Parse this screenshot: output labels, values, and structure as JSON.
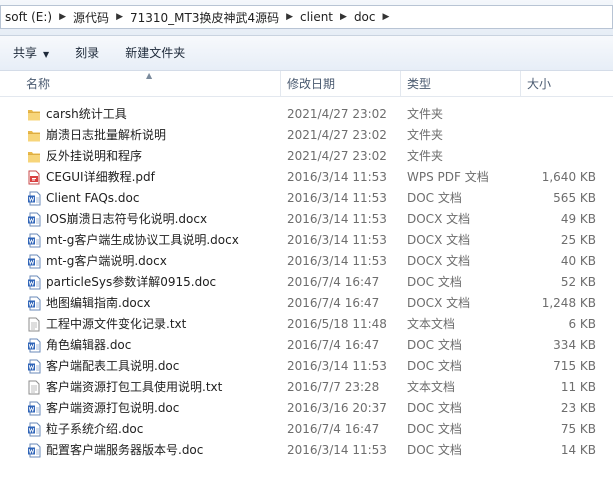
{
  "breadcrumb": [
    "soft (E:)",
    "源代码",
    "71310_MT3换皮神武4源码",
    "client",
    "doc"
  ],
  "toolbar": {
    "share": "共享",
    "burn": "刻录",
    "new_folder": "新建文件夹"
  },
  "columns": {
    "name": "名称",
    "date": "修改日期",
    "type": "类型",
    "size": "大小"
  },
  "files": [
    {
      "name": "carsh统计工具",
      "date": "2021/4/27 23:02",
      "type": "文件夹",
      "size": "",
      "icon": "folder-icon"
    },
    {
      "name": "崩溃日志批量解析说明",
      "date": "2021/4/27 23:02",
      "type": "文件夹",
      "size": "",
      "icon": "folder-icon"
    },
    {
      "name": "反外挂说明和程序",
      "date": "2021/4/27 23:02",
      "type": "文件夹",
      "size": "",
      "icon": "folder-icon"
    },
    {
      "name": "CEGUI详细教程.pdf",
      "date": "2016/3/14 11:53",
      "type": "WPS PDF 文档",
      "size": "1,640 KB",
      "icon": "pdf-icon"
    },
    {
      "name": "Client FAQs.doc",
      "date": "2016/3/14 11:53",
      "type": "DOC 文档",
      "size": "565 KB",
      "icon": "word-doc-icon"
    },
    {
      "name": "IOS崩溃日志符号化说明.docx",
      "date": "2016/3/14 11:53",
      "type": "DOCX 文档",
      "size": "49 KB",
      "icon": "word-doc-icon"
    },
    {
      "name": "mt-g客户端生成协议工具说明.docx",
      "date": "2016/3/14 11:53",
      "type": "DOCX 文档",
      "size": "25 KB",
      "icon": "word-doc-icon"
    },
    {
      "name": "mt-g客户端说明.docx",
      "date": "2016/3/14 11:53",
      "type": "DOCX 文档",
      "size": "40 KB",
      "icon": "word-doc-icon"
    },
    {
      "name": "particleSys参数详解0915.doc",
      "date": "2016/7/4 16:47",
      "type": "DOC 文档",
      "size": "52 KB",
      "icon": "word-doc-icon"
    },
    {
      "name": "地图编辑指南.docx",
      "date": "2016/7/4 16:47",
      "type": "DOCX 文档",
      "size": "1,248 KB",
      "icon": "word-doc-icon"
    },
    {
      "name": "工程中源文件变化记录.txt",
      "date": "2016/5/18 11:48",
      "type": "文本文档",
      "size": "6 KB",
      "icon": "text-file-icon"
    },
    {
      "name": "角色编辑器.doc",
      "date": "2016/7/4 16:47",
      "type": "DOC 文档",
      "size": "334 KB",
      "icon": "word-doc-icon"
    },
    {
      "name": "客户端配表工具说明.doc",
      "date": "2016/3/14 11:53",
      "type": "DOC 文档",
      "size": "715 KB",
      "icon": "word-doc-icon"
    },
    {
      "name": "客户端资源打包工具使用说明.txt",
      "date": "2016/7/7 23:28",
      "type": "文本文档",
      "size": "11 KB",
      "icon": "text-file-icon"
    },
    {
      "name": "客户端资源打包说明.doc",
      "date": "2016/3/16 20:37",
      "type": "DOC 文档",
      "size": "23 KB",
      "icon": "word-doc-icon"
    },
    {
      "name": "粒子系统介绍.doc",
      "date": "2016/7/4 16:47",
      "type": "DOC 文档",
      "size": "75 KB",
      "icon": "word-doc-icon"
    },
    {
      "name": "配置客户端服务器版本号.doc",
      "date": "2016/3/14 11:53",
      "type": "DOC 文档",
      "size": "14 KB",
      "icon": "word-doc-icon"
    }
  ]
}
